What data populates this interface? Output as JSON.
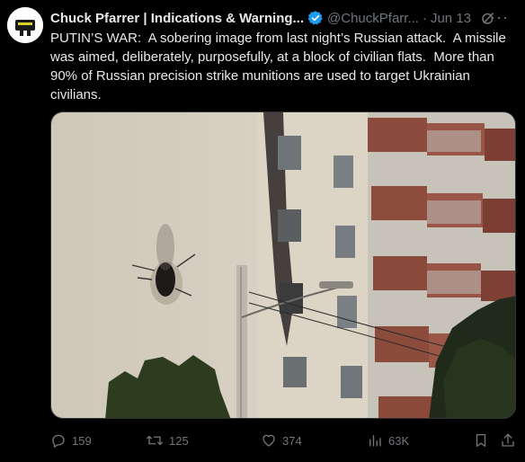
{
  "author": {
    "name": "Chuck Pfarrer | Indications & Warning...",
    "handle": "@ChuckPfarr...",
    "date": "Jun 13",
    "separator": "·",
    "avatar_icon": "avatar-image",
    "verified_color": "#1d9bf0"
  },
  "tweet": {
    "text": "PUTIN’S WAR:  A sobering image from last night’s Russian attack.  A missile was aimed, deliberately, purposefully, at a block of civilian flats.  More than 90% of Russian precision strike munitions are used to target Ukrainian civilians."
  },
  "media": {
    "description_icon": "photo-apartment-building-missile-hole"
  },
  "actions": {
    "replies": "159",
    "reposts": "125",
    "likes": "374",
    "views": "63K",
    "more_label": "···"
  },
  "colors": {
    "background": "#000000",
    "text": "#e7e9ea",
    "secondary": "#71767b",
    "accent": "#1d9bf0"
  }
}
